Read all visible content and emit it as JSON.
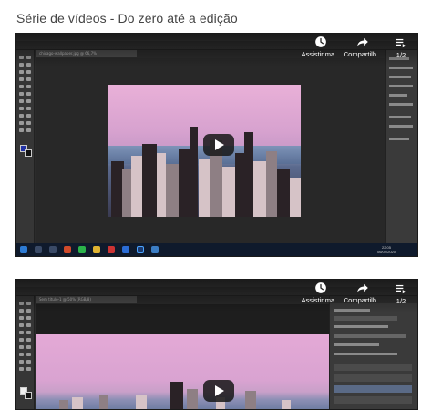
{
  "page": {
    "title": "Série de vídeos - Do zero até a edição"
  },
  "player": {
    "watch_later_label": "Assistir ma...",
    "share_label": "Compartilh...",
    "playlist_position": "1/2",
    "icons": {
      "watch_later": "clock-icon",
      "share": "share-arrow-icon",
      "playlist": "playlist-icon",
      "play": "play-icon"
    },
    "colors": {
      "play_button_bg": "#171717",
      "label": "#ffffff"
    }
  },
  "videos": [
    {
      "id_label": "video-1",
      "taskbar_time": "22:05",
      "taskbar_date": "06/04/2020"
    },
    {
      "id_label": "video-2"
    }
  ]
}
